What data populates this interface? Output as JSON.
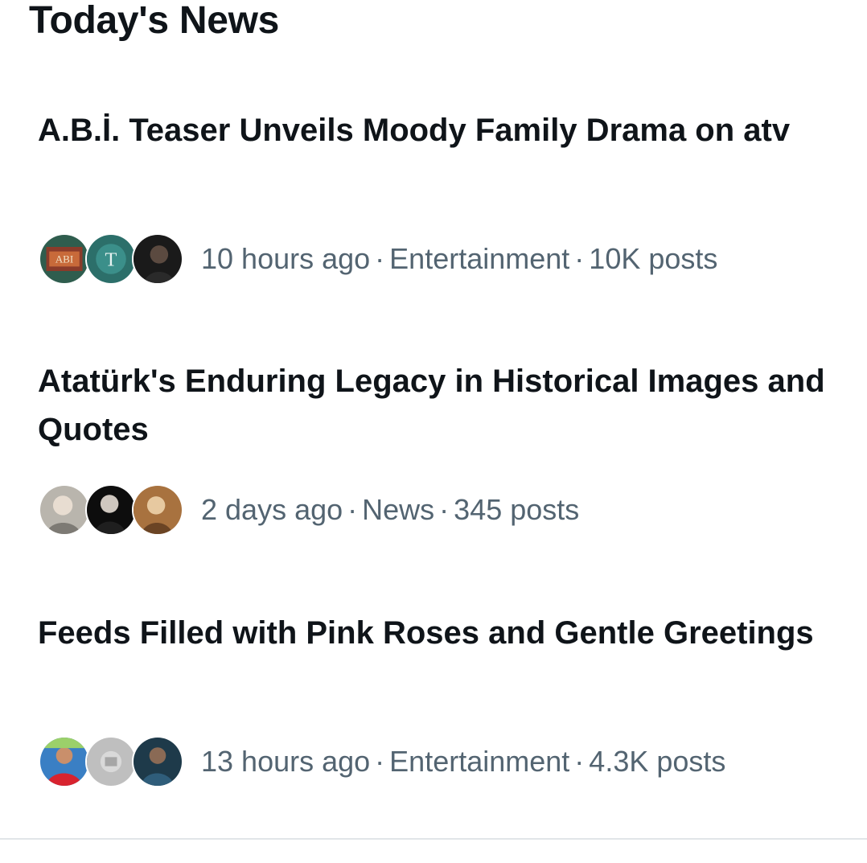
{
  "section": {
    "title": "Today's News"
  },
  "news": [
    {
      "headline": "A.B.İ. Teaser Unveils Moody Family Drama on atv",
      "time": "10 hours ago",
      "category": "Entertainment",
      "posts": "10K posts",
      "avatars": [
        "abi-logo-avatar",
        "t-logo-avatar",
        "man-portrait-avatar"
      ]
    },
    {
      "headline": "Atatürk's Enduring Legacy in Historical Images and Quotes",
      "time": "2 days ago",
      "category": "News",
      "posts": "345 posts",
      "avatars": [
        "historical-portrait-avatar",
        "man-portrait-avatar",
        "sepia-portrait-avatar"
      ]
    },
    {
      "headline": "Feeds Filled with Pink Roses and Gentle Greetings",
      "time": "13 hours ago",
      "category": "Entertainment",
      "posts": "4.3K posts",
      "avatars": [
        "woman-portrait-avatar",
        "gray-image-avatar",
        "man-portrait-avatar"
      ]
    }
  ],
  "separator": "·"
}
